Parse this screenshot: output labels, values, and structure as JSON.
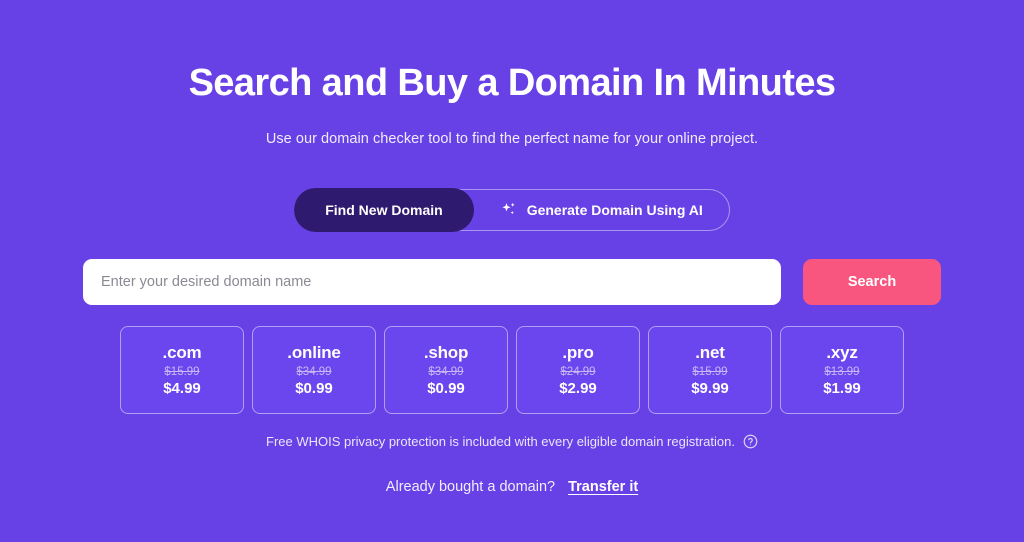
{
  "colors": {
    "background": "#6740e6",
    "active_pill": "#2e1a6e",
    "search_button": "#f8567f",
    "card_fill": "#6b46ee",
    "card_border": "#b0a0f3",
    "muted_text": "#c6b8f4"
  },
  "hero": {
    "title": "Search and Buy a Domain In Minutes",
    "subtitle": "Use our domain checker tool to find the perfect name for your online project."
  },
  "toggle": {
    "options": [
      {
        "label": "Find New Domain",
        "active": true,
        "icon": ""
      },
      {
        "label": "Generate Domain Using AI",
        "active": false,
        "icon": "sparkle-icon"
      }
    ]
  },
  "search": {
    "placeholder": "Enter your desired domain name",
    "value": "",
    "button_label": "Search"
  },
  "tlds": [
    {
      "name": ".com",
      "old_price": "$15.99",
      "new_price": "$4.99"
    },
    {
      "name": ".online",
      "old_price": "$34.99",
      "new_price": "$0.99"
    },
    {
      "name": ".shop",
      "old_price": "$34.99",
      "new_price": "$0.99"
    },
    {
      "name": ".pro",
      "old_price": "$24.99",
      "new_price": "$2.99"
    },
    {
      "name": ".net",
      "old_price": "$15.99",
      "new_price": "$9.99"
    },
    {
      "name": ".xyz",
      "old_price": "$13.99",
      "new_price": "$1.99"
    }
  ],
  "whois": {
    "text": "Free WHOIS privacy protection is included with every eligible domain registration.",
    "icon": "help-circle-icon"
  },
  "transfer": {
    "question": "Already bought a domain?",
    "link_label": "Transfer it"
  }
}
